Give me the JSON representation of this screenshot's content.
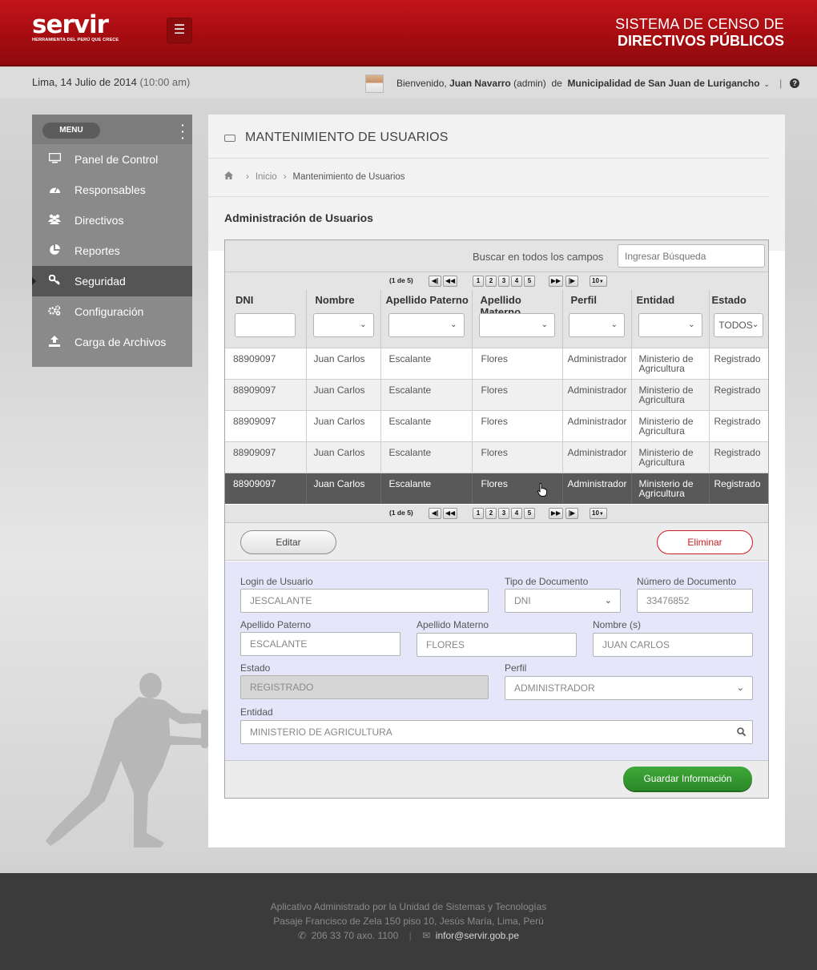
{
  "header": {
    "logo_text": "servir",
    "logo_tagline": "HERRAMIENTA DEL PERÚ QUE CRECE",
    "menu_icon": "hamburger-icon",
    "system_title_line1": "SISTEMA DE CENSO  DE",
    "system_title_line2": "DIRECTIVOS PÚBLICOS"
  },
  "subbar": {
    "date": "Lima, 14 Julio de 2014",
    "time": "(10:00 am)",
    "welcome": "Bienvenido,",
    "user_name": "Juan Navarro",
    "user_role": "(admin)",
    "de": "de",
    "entity": "Municipalidad de San Juan de Lurigancho",
    "separator": "|"
  },
  "sidebar": {
    "menu_label": "MENU",
    "items": [
      {
        "label": "Panel de Control",
        "icon": "monitor-icon"
      },
      {
        "label": "Responsables",
        "icon": "dashboard-icon"
      },
      {
        "label": "Directivos",
        "icon": "users-icon"
      },
      {
        "label": "Reportes",
        "icon": "pie-chart-icon"
      },
      {
        "label": "Seguridad",
        "icon": "key-icon",
        "active": true
      },
      {
        "label": "Configuración",
        "icon": "cogs-icon"
      },
      {
        "label": "Carga de Archivos",
        "icon": "upload-icon"
      }
    ]
  },
  "main": {
    "title": "MANTENIMIENTO DE USUARIOS",
    "breadcrumb": {
      "home": "home-icon",
      "items": [
        "Inicio",
        "Mantenimiento de Usuarios"
      ]
    },
    "section_title": "Administración de Usuarios",
    "search": {
      "label": "Buscar en todos los campos",
      "placeholder": "Ingresar Búsqueda"
    },
    "pager": {
      "info": "(1 de 5)",
      "pages": [
        "1",
        "2",
        "3",
        "4",
        "5"
      ],
      "page_size": "10"
    },
    "columns": [
      "DNI",
      "Nombre",
      "Apellido Paterno",
      "Apellido Materno",
      "Perfil",
      "Entidad",
      "Estado"
    ],
    "estado_filter": "TODOS",
    "rows": [
      [
        "88909097",
        "Juan Carlos",
        "Escalante",
        "Flores",
        "Administrador",
        "Ministerio de Agricultura",
        "Registrado"
      ],
      [
        "88909097",
        "Juan Carlos",
        "Escalante",
        "Flores",
        "Administrador",
        "Ministerio de Agricultura",
        "Registrado"
      ],
      [
        "88909097",
        "Juan Carlos",
        "Escalante",
        "Flores",
        "Administrador",
        "Ministerio de Agricultura",
        "Registrado"
      ],
      [
        "88909097",
        "Juan Carlos",
        "Escalante",
        "Flores",
        "Administrador",
        "Ministerio de Agricultura",
        "Registrado"
      ],
      [
        "88909097",
        "Juan Carlos",
        "Escalante",
        "Flores",
        "Administrador",
        "Ministerio de Agricultura",
        "Registrado"
      ]
    ],
    "selected_row": 4,
    "edit_label": "Editar",
    "delete_label": "Eliminar",
    "form": {
      "login_label": "Login de Usuario",
      "login_value": "JESCALANTE",
      "doc_type_label": "Tipo de Documento",
      "doc_type_value": "DNI",
      "doc_number_label": "Número de Documento",
      "doc_number_value": "33476852",
      "apellido_paterno_label": "Apellido Paterno",
      "apellido_paterno_value": "ESCALANTE",
      "apellido_materno_label": "Apellido Materno",
      "apellido_materno_value": "FLORES",
      "nombre_label": "Nombre (s)",
      "nombre_value": "JUAN CARLOS",
      "estado_label": "Estado",
      "estado_value": "REGISTRADO",
      "perfil_label": "Perfil",
      "perfil_value": "ADMINISTRADOR",
      "entidad_label": "Entidad",
      "entidad_value": "MINISTERIO DE AGRICULTURA"
    },
    "save_label": "Guardar Información"
  },
  "footer": {
    "line1": "Aplicativo Administrado por la Unidad de Sistemas y Tecnologías",
    "line2": "Pasaje Francisco de Zela 150 piso 10, Jesús María, Lima, Perú",
    "phone": "206 33 70 axo. 1100",
    "email": "infor@servir.gob.pe",
    "separator": "|"
  },
  "colors": {
    "brand_red": "#b3111a",
    "save_green": "#2f942b",
    "form_bg": "#e5e6fa",
    "selected_row": "#595959"
  }
}
